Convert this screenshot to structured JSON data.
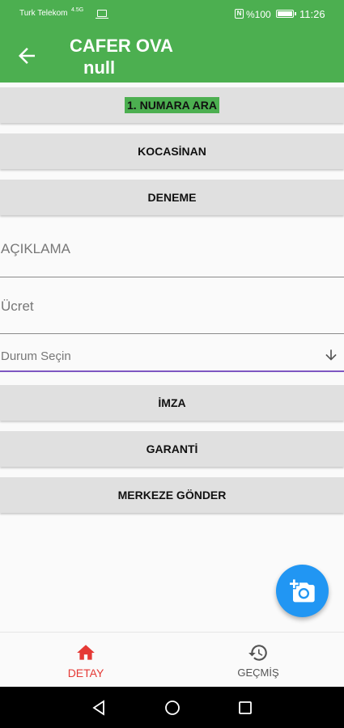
{
  "status_bar": {
    "carrier": "Turk Telekom",
    "network": "4.5G",
    "battery_percent": "%100",
    "time": "11:26"
  },
  "app_bar": {
    "title": "CAFER OVA",
    "subtitle": "null",
    "color": "#4CAF50"
  },
  "action_buttons": {
    "call_number": "1. NUMARA ARA",
    "location_1": "KOCASİNAN",
    "location_2": "DENEME"
  },
  "form": {
    "description_placeholder": "AÇIKLAMA",
    "fee_placeholder": "Ücret",
    "status_placeholder": "Durum Seçin"
  },
  "bottom_buttons": {
    "signature": "İMZA",
    "warranty": "GARANTİ",
    "send_center": "MERKEZE GÖNDER"
  },
  "fab": {
    "icon": "add-photo-icon",
    "color": "#2196F3"
  },
  "bottom_nav": {
    "items": [
      {
        "label": "DETAY",
        "icon": "home-icon",
        "active": true,
        "color": "#e53935"
      },
      {
        "label": "GEÇMİŞ",
        "icon": "history-icon",
        "active": false,
        "color": "#555555"
      }
    ]
  }
}
